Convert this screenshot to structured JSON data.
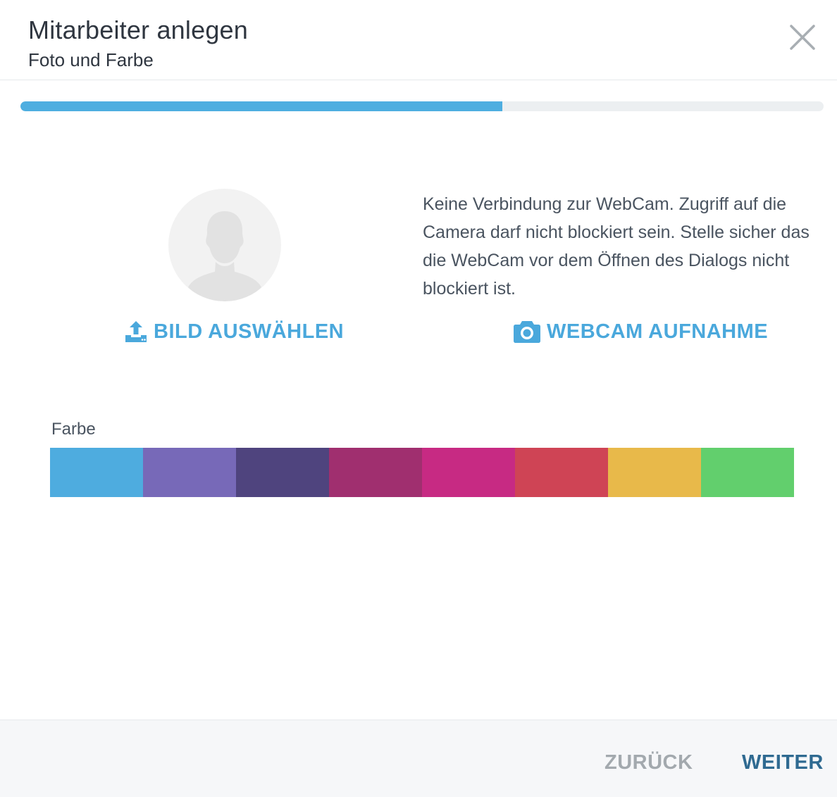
{
  "dialog": {
    "title": "Mitarbeiter anlegen",
    "subtitle": "Foto und Farbe"
  },
  "progress": {
    "fraction": 0.6
  },
  "photo": {
    "webcam_message": "Keine Verbindung zur WebCam. Zugriff auf die Camera darf nicht blockiert sein. Stelle sicher das die WebCam vor dem Öffnen des Dialogs nicht blockiert ist.",
    "upload_label": "BILD AUSWÄHLEN",
    "upload_icon": "upload-icon",
    "webcam_label": "WEBCAM AUFNAHME",
    "webcam_icon": "camera-icon"
  },
  "color": {
    "label": "Farbe",
    "swatches": [
      "#4eacdf",
      "#7769b8",
      "#4f447e",
      "#a02f6f",
      "#c72a83",
      "#cf4455",
      "#e8b94a",
      "#62cf6d"
    ]
  },
  "footer": {
    "back_label": "ZURÜCK",
    "next_label": "WEITER"
  },
  "colors": {
    "accent": "#4aa8dc",
    "primary_text": "#2f3640",
    "next_button": "#2f6a91",
    "back_button": "#a3a9ae"
  }
}
